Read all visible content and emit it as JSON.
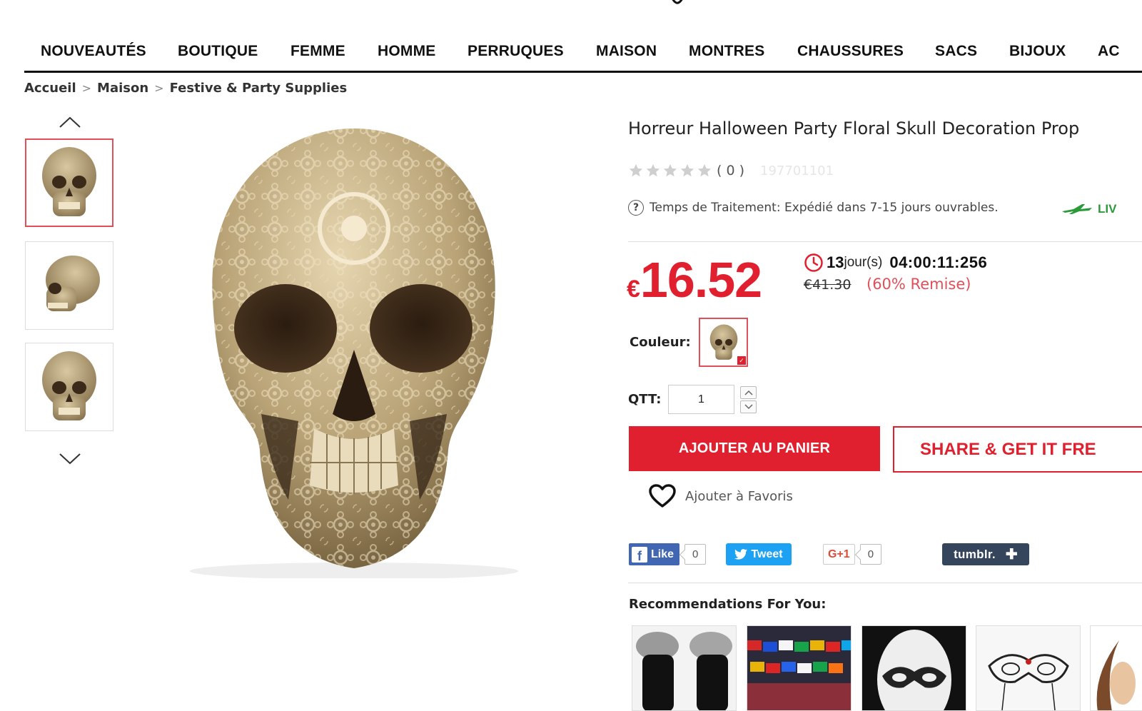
{
  "nav": {
    "items": [
      "NOUVEAUTÉS",
      "BOUTIQUE",
      "FEMME",
      "HOMME",
      "PERRUQUES",
      "MAISON",
      "MONTRES",
      "CHAUSSURES",
      "SACS",
      "BIJOUX",
      "AC"
    ]
  },
  "breadcrumb": {
    "home": "Accueil",
    "category": "Maison",
    "subcategory": "Festive & Party Supplies",
    "separator": ">"
  },
  "gallery": {
    "prev_icon": "chevron-up-icon",
    "next_icon": "chevron-down-icon",
    "thumbnail_count": 3,
    "active_index": 0
  },
  "product": {
    "title": "Horreur Halloween Party Floral Skull Decoration Prop",
    "rating_count": "( 0 )",
    "sku": "197701101",
    "processing_label": "Temps de Traitement:",
    "processing_value": "Expédié dans 7-15 jours ouvrables.",
    "delivery_text": "LIV",
    "currency": "€",
    "price": "16.52",
    "countdown_days": "13",
    "countdown_days_label": "jour(s)",
    "countdown_time": "04:00:11:256",
    "old_price": "€41.30",
    "discount": "(60% Remise)",
    "color_label": "Couleur:",
    "qty_label": "QTT:",
    "qty_value": "1",
    "add_to_cart": "AJOUTER AU PANIER",
    "share_button": "SHARE & GET IT FRE",
    "favorite": "Ajouter à Favoris"
  },
  "social": {
    "fb_label": "Like",
    "fb_count": "0",
    "tweet_label": "Tweet",
    "gplus_label": "G+1",
    "gplus_count": "0",
    "tumblr_label": "tumblr."
  },
  "recommendations": {
    "title": "Recommendations For You:",
    "items": [
      "fur-gloves",
      "flags-banner",
      "lace-mask-white",
      "lace-mask-black",
      "partial-item"
    ]
  },
  "colors": {
    "accent_red": "#e0202e",
    "discount_red": "#e0505a",
    "delivery_green": "#2c9a3a",
    "facebook": "#4267b2",
    "twitter": "#1da1f2",
    "tumblr": "#35465c"
  }
}
